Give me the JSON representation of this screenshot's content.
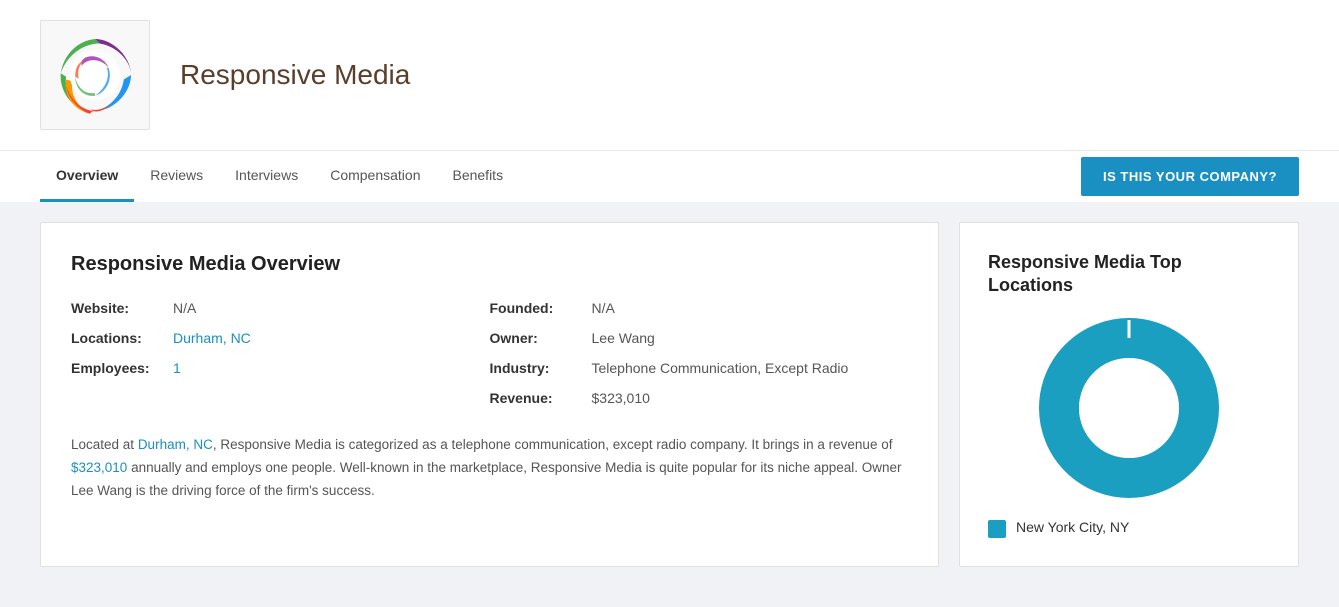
{
  "header": {
    "company_name": "Responsive Media"
  },
  "nav": {
    "tabs": [
      {
        "label": "Overview",
        "active": true
      },
      {
        "label": "Reviews",
        "active": false
      },
      {
        "label": "Interviews",
        "active": false
      },
      {
        "label": "Compensation",
        "active": false
      },
      {
        "label": "Benefits",
        "active": false
      }
    ],
    "claim_button": "IS THIS YOUR COMPANY?"
  },
  "overview": {
    "title": "Responsive Media Overview",
    "fields": {
      "website_label": "Website:",
      "website_value": "N/A",
      "locations_label": "Locations:",
      "locations_value": "Durham, NC",
      "employees_label": "Employees:",
      "employees_value": "1",
      "founded_label": "Founded:",
      "founded_value": "N/A",
      "owner_label": "Owner:",
      "owner_value": "Lee Wang",
      "industry_label": "Industry:",
      "industry_value": "Telephone Communication, Except Radio",
      "revenue_label": "Revenue:",
      "revenue_value": "$323,010"
    },
    "description": "Located at Durham, NC, Responsive Media is categorized as a telephone communication, except radio company. It brings in a revenue of $323,010 annually and employs one people. Well-known in the marketplace, Responsive Media is quite popular for its niche appeal. Owner Lee Wang is the driving force of the firm's success."
  },
  "top_locations": {
    "title": "Responsive Media Top Locations",
    "legend": {
      "color": "#1a9fc0",
      "label": "New York City, NY"
    }
  }
}
